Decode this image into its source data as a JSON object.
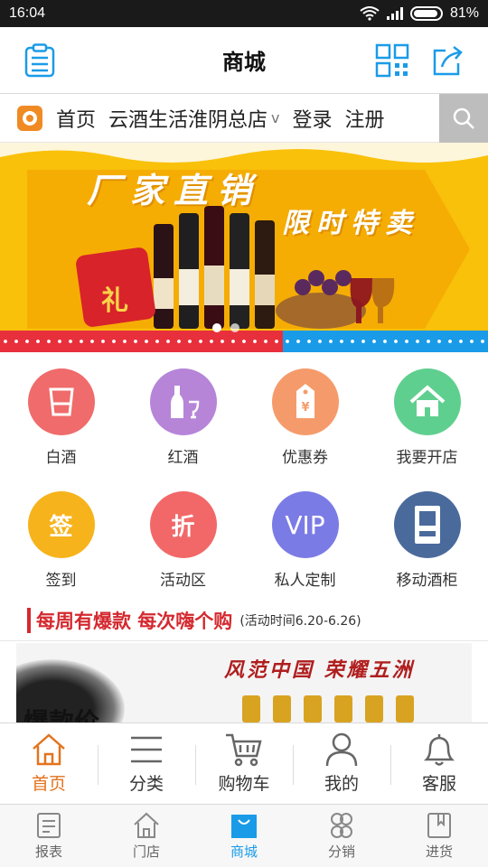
{
  "status": {
    "time": "16:04",
    "battery": "81%"
  },
  "appbar": {
    "title": "商城"
  },
  "nav": {
    "home": "首页",
    "store": "云酒生活淮阴总店",
    "store_arrow": "v",
    "login": "登录",
    "register": "注册"
  },
  "banner": {
    "headline": "厂家直销",
    "subline": "限时特卖",
    "gift_char": "礼"
  },
  "grid": [
    {
      "label": "白酒",
      "color": "#f06b6b",
      "icon": "glass-icon"
    },
    {
      "label": "红酒",
      "color": "#b685d8",
      "icon": "wine-icon"
    },
    {
      "label": "优惠券",
      "color": "#f59b6b",
      "icon": "coupon-icon"
    },
    {
      "label": "我要开店",
      "color": "#5fcf8f",
      "icon": "house-icon"
    },
    {
      "label": "签到",
      "color": "#f6b31b",
      "icon": "checkin-icon",
      "glyph": "签"
    },
    {
      "label": "活动区",
      "color": "#f26868",
      "icon": "discount-icon",
      "glyph": "折"
    },
    {
      "label": "私人定制",
      "color": "#7b7be6",
      "icon": "vip-icon",
      "glyph": "VIP"
    },
    {
      "label": "移动酒柜",
      "color": "#4a6a9c",
      "icon": "cabinet-icon"
    }
  ],
  "promo": {
    "main": "每周有爆款 每次嗨个购",
    "sub": "(活动时间6.20-6.26)"
  },
  "promo2": {
    "slogan": "风范中国 荣耀五洲",
    "bigtext": "爆款价"
  },
  "tabs_primary": [
    {
      "label": "首页",
      "icon": "home-icon",
      "active": true
    },
    {
      "label": "分类",
      "icon": "menu-icon"
    },
    {
      "label": "购物车",
      "icon": "cart-icon"
    },
    {
      "label": "我的",
      "icon": "user-icon"
    },
    {
      "label": "客服",
      "icon": "bell-icon"
    }
  ],
  "tabs_secondary": [
    {
      "label": "报表",
      "icon": "report-icon"
    },
    {
      "label": "门店",
      "icon": "store-icon"
    },
    {
      "label": "商城",
      "icon": "bag-icon",
      "active": true
    },
    {
      "label": "分销",
      "icon": "distribution-icon"
    },
    {
      "label": "进货",
      "icon": "purchase-icon"
    }
  ],
  "colors": {
    "accent": "#e3731d",
    "blue": "#1a9be8",
    "promo_red": "#d4292f"
  }
}
